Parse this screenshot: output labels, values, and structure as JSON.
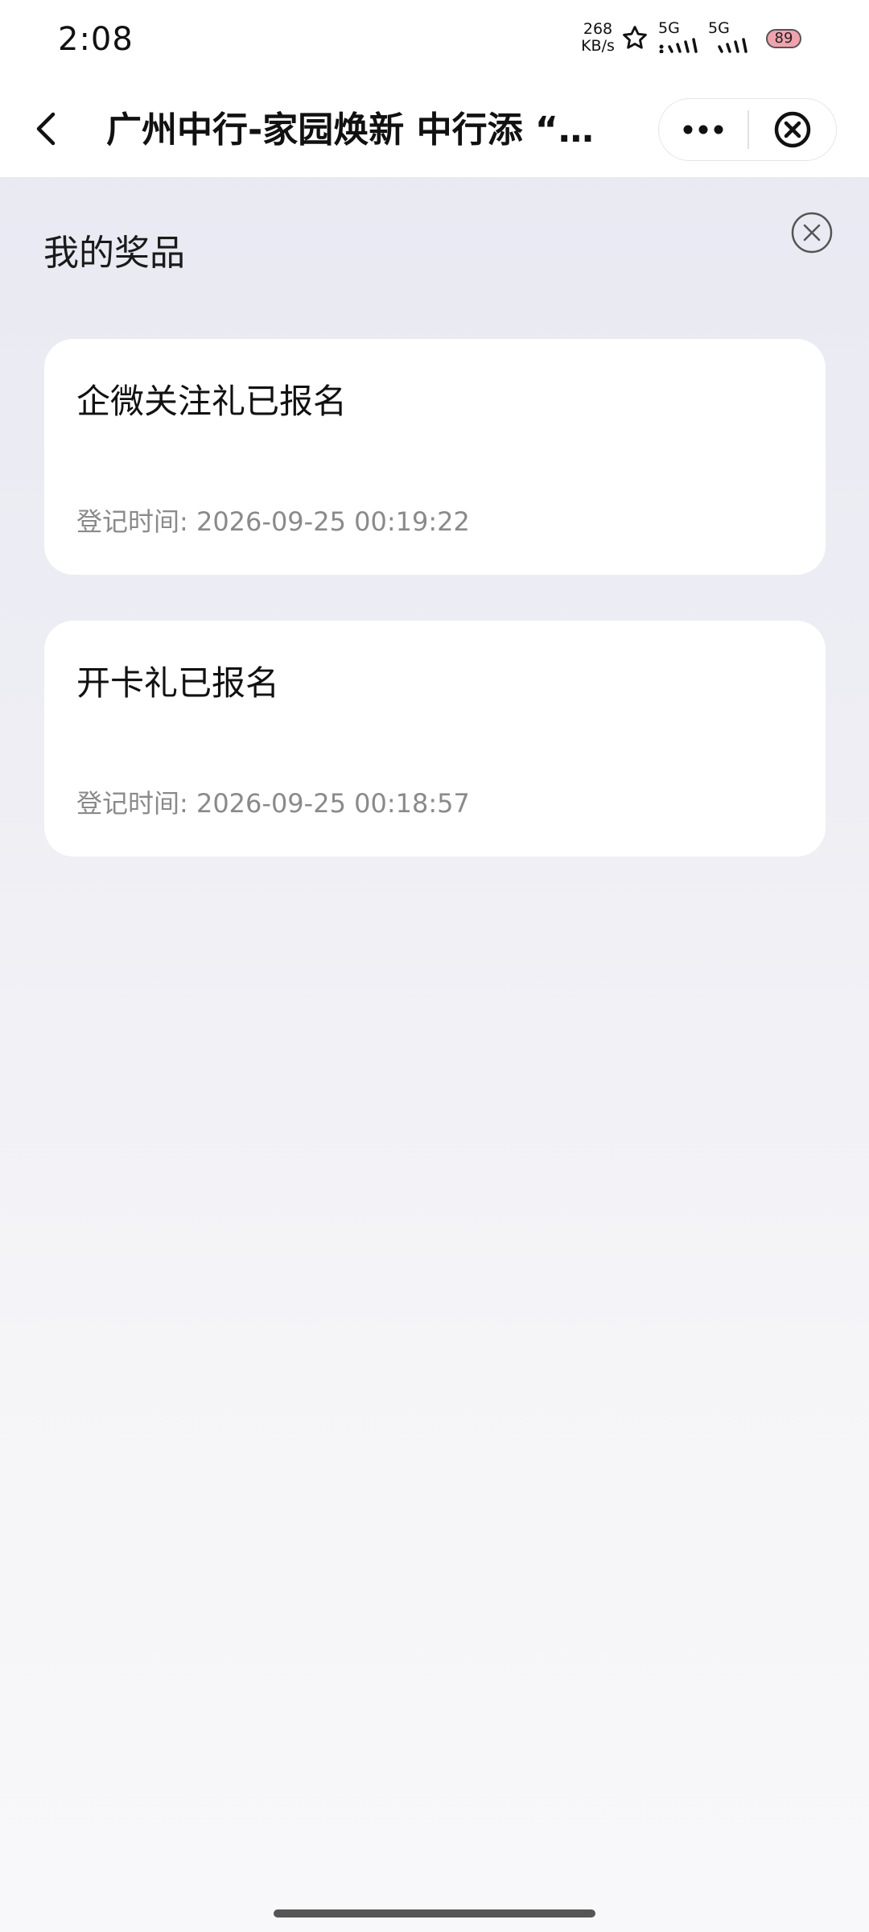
{
  "status_bar": {
    "time": "2:08",
    "net_speed_value": "268",
    "net_speed_unit": "KB/s",
    "signal_1_label": "5G",
    "signal_2_label": "5G",
    "battery": "89",
    "icons": [
      "star-icon",
      "signal-icon",
      "battery-icon"
    ]
  },
  "nav": {
    "title": "广州中行-家园焕新 中行添 “…",
    "icons": [
      "back-icon",
      "more-icon",
      "close-circle-icon"
    ]
  },
  "panel": {
    "title": "我的奖品",
    "close_icon": "close-circle-icon"
  },
  "prizes": [
    {
      "name": "企微关注礼已报名",
      "time": "登记时间: 2026-09-25 00:19:22"
    },
    {
      "name": "开卡礼已报名",
      "time": "登记时间: 2026-09-25 00:18:57"
    }
  ],
  "colors": {
    "background": "#e7e8f2",
    "card": "#ffffff",
    "battery": "#f0a3ae",
    "secondary_text": "#8a8a8a"
  }
}
